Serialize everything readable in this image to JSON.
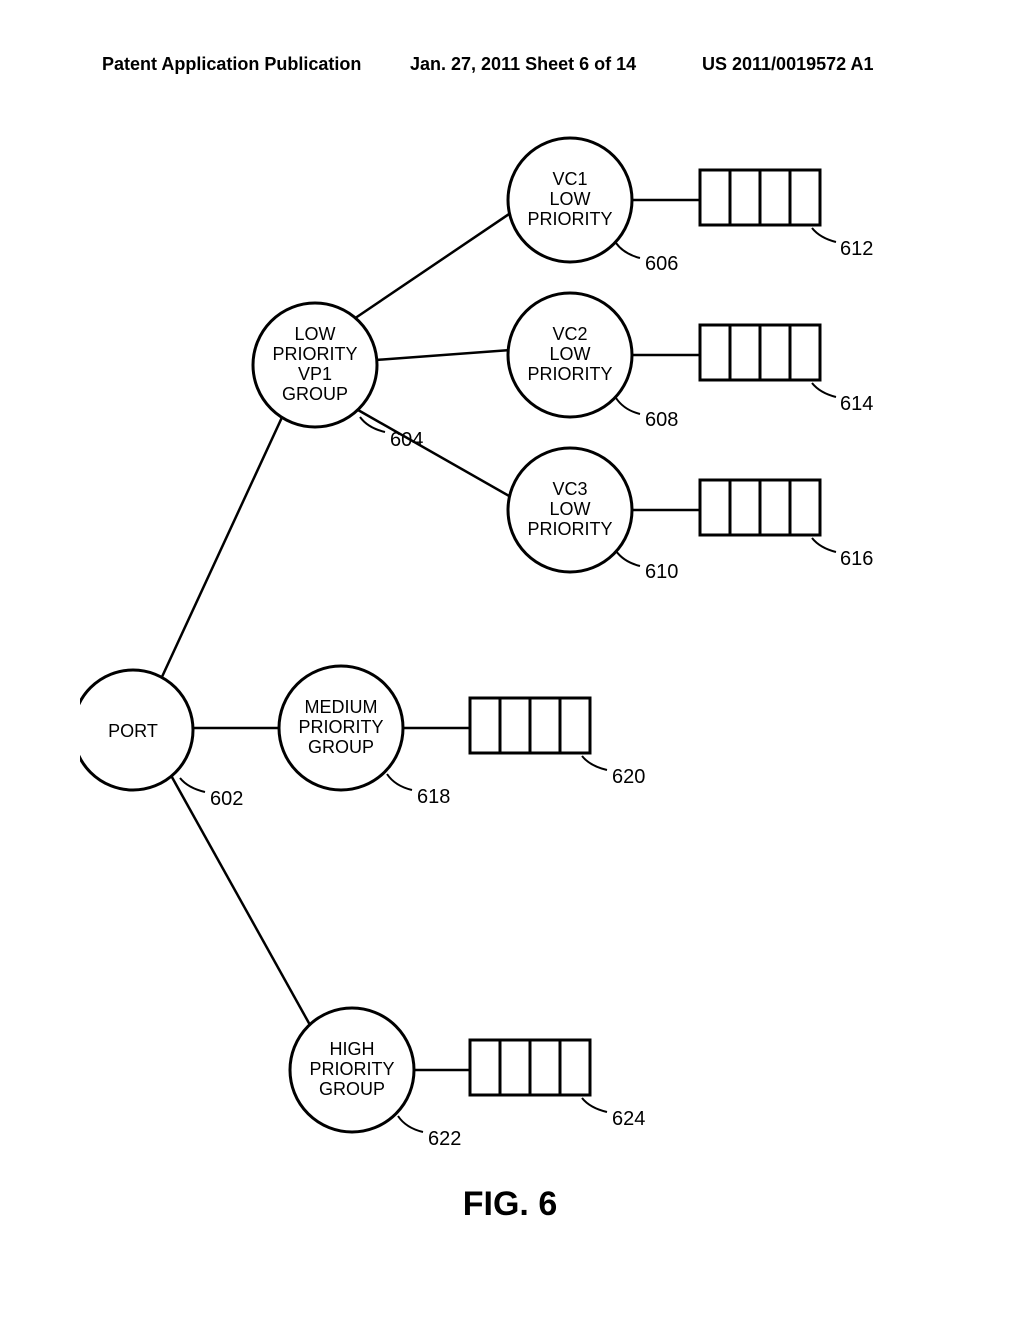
{
  "header": {
    "left": "Patent Application Publication",
    "center": "Jan. 27, 2011  Sheet 6 of 14",
    "right": "US 2011/0019572 A1"
  },
  "nodes": {
    "port": {
      "lines": [
        "PORT"
      ],
      "ref": "602"
    },
    "low_group": {
      "lines": [
        "LOW",
        "PRIORITY",
        "VP1",
        "GROUP"
      ],
      "ref": "604"
    },
    "vc1": {
      "lines": [
        "VC1",
        "LOW",
        "PRIORITY"
      ],
      "ref": "606"
    },
    "vc2": {
      "lines": [
        "VC2",
        "LOW",
        "PRIORITY"
      ],
      "ref": "608"
    },
    "vc3": {
      "lines": [
        "VC3",
        "LOW",
        "PRIORITY"
      ],
      "ref": "610"
    },
    "medium_group": {
      "lines": [
        "MEDIUM",
        "PRIORITY",
        "GROUP"
      ],
      "ref": "618"
    },
    "high_group": {
      "lines": [
        "HIGH",
        "PRIORITY",
        "GROUP"
      ],
      "ref": "622"
    }
  },
  "queues": {
    "q612": "612",
    "q614": "614",
    "q616": "616",
    "q620": "620",
    "q624": "624"
  },
  "figure_label": "FIG. 6"
}
